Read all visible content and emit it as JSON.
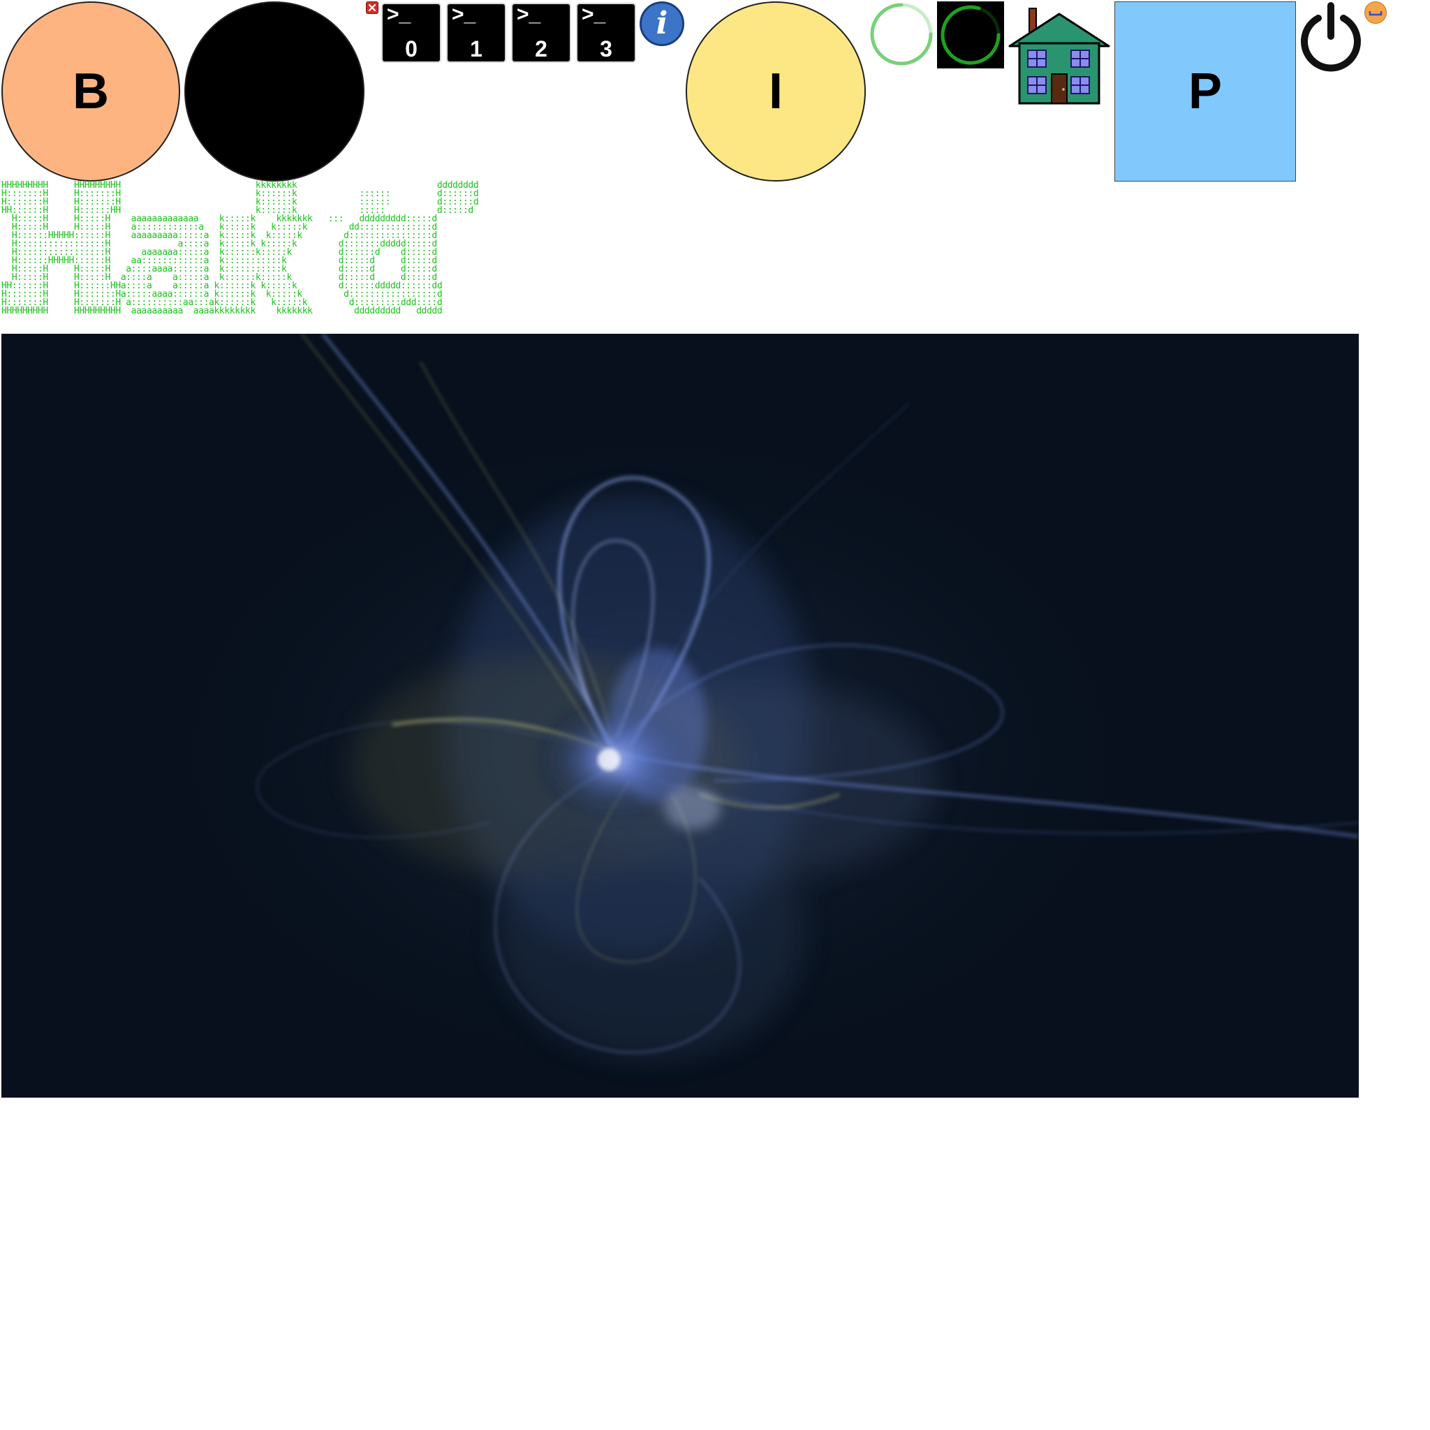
{
  "buttons": {
    "b_label": "B",
    "i_label": "I",
    "p_label": "P"
  },
  "terminals": [
    {
      "prompt": ">_",
      "number": "0"
    },
    {
      "prompt": ">_",
      "number": "1"
    },
    {
      "prompt": ">_",
      "number": "2"
    },
    {
      "prompt": ">_",
      "number": "3"
    }
  ],
  "info_icon": {
    "glyph": "i"
  },
  "banner": {
    "ascii": "HHHHHHHHH     HHHHHHHHH                          kkkkkkkk                           dddddddd\nH:::::::H     H:::::::H                          k::::::k            ::::::         d::::::d\nH:::::::H     H:::::::H                          k::::::k            ::::::         d::::::d\nHH::::::H     H::::::HH                          k::::::k            :::::          d:::::d \n  H:::::H     H:::::H    aaaaaaaaaaaaa    k:::::k    kkkkkkk   :::   ddddddddd:::::d \n  H:::::H     H:::::H    a::::::::::::a   k:::::k   k:::::k        dd::::::::::::::d \n  H::::::HHHHH::::::H    aaaaaaaaa:::::a  k:::::k  k:::::k        d::::::::::::::::d \n  H:::::::::::::::::H             a::::a  k:::::k k:::::k        d:::::::ddddd:::::d \n  H:::::::::::::::::H      aaaaaaa:::::a  k::::::k:::::k         d::::::d    d:::::d \n  H::::::HHHHH::::::H    aa::::::::::::a  k:::::::::::k          d:::::d     d:::::d \n  H:::::H     H:::::H   a::::aaaa::::::a  k:::::::::::k          d:::::d     d:::::d \n  H:::::H     H:::::H  a::::a    a:::::a  k::::::k:::::k         d:::::d     d:::::d \nHH::::::H     H::::::HHa::::a    a:::::a k::::::k k:::::k        d::::::ddddd::::::dd\nH:::::::H     H:::::::Ha:::::aaaa::::::a k::::::k  k:::::k        d:::::::::::::::::d\nH:::::::H     H:::::::H a::::::::::aa:::ak::::::k   k:::::k        d:::::::::ddd::::d\nHHHHHHHHH     HHHHHHHHH  aaaaaaaaaa  aaaakkkkkkkk    kkkkkkk        ddddddddd   ddddd"
  },
  "colors": {
    "b_button": "#fdb481",
    "dark_button": "#000000",
    "i_button": "#fde784",
    "p_button": "#81c8fd",
    "ascii_green": "#1cc21c",
    "info_blue": "#3c74c8",
    "house_green": "#2a9470",
    "wallpaper_bg": "#07101c"
  },
  "icons": {
    "close": "close-icon",
    "info": "info-icon",
    "spinner_light": "loading-spinner-icon",
    "spinner_dark": "loading-spinner-dark-icon",
    "home": "home-icon",
    "power": "power-icon",
    "minimize": "minimize-icon"
  }
}
